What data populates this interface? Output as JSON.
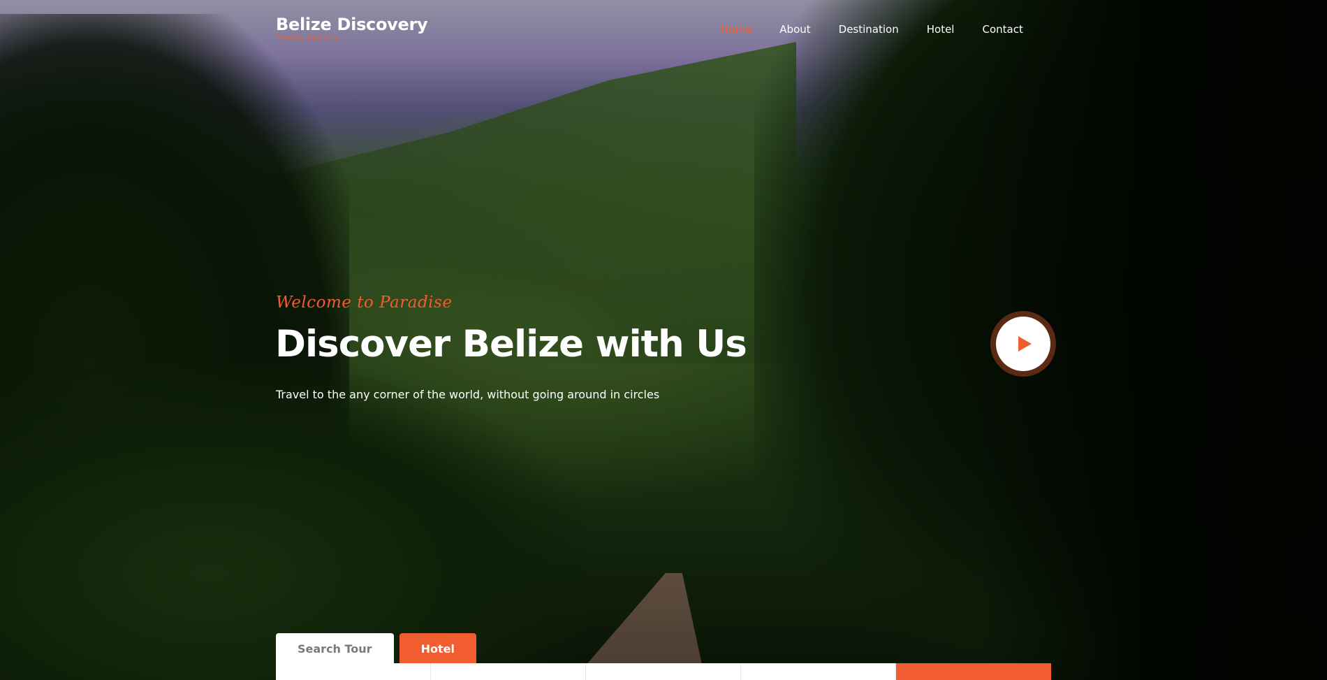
{
  "brand": {
    "title": "Belize Discovery",
    "subtitle": "TRAVEL AGENCY"
  },
  "nav": {
    "items": [
      {
        "label": "Home",
        "active": true
      },
      {
        "label": "About",
        "active": false
      },
      {
        "label": "Destination",
        "active": false
      },
      {
        "label": "Hotel",
        "active": false
      },
      {
        "label": "Contact",
        "active": false
      }
    ]
  },
  "hero": {
    "welcome": "Welcome to Paradise",
    "headline": "Discover Belize with Us",
    "tagline": "Travel to the any corner of the world, without going around in circles"
  },
  "search": {
    "tabs": [
      {
        "label": "Search Tour",
        "active": true
      },
      {
        "label": "Hotel",
        "active": false
      }
    ]
  },
  "colors": {
    "accent": "#f15d30",
    "text": "#ffffff",
    "play_ring": "#5a2a14"
  },
  "icons": {
    "play": "play-icon"
  }
}
